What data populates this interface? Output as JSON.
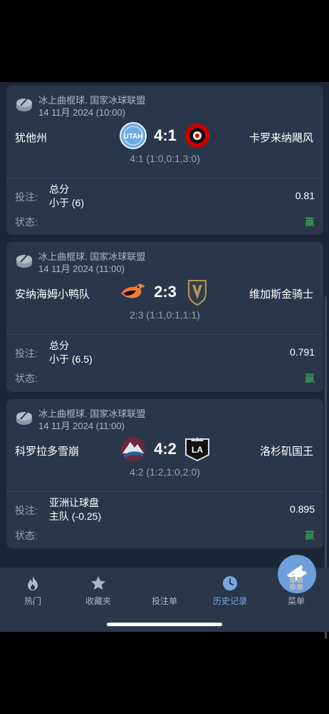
{
  "matches": [
    {
      "league": "冰上曲棍球. 国家冰球联盟",
      "date": "14 11月 2024 (10:00)",
      "home": "犹他州",
      "away": "卡罗来纳飓风",
      "score": "4:1",
      "periods": "4:1 (1:0,0:1,3:0)",
      "bet_label": "投注:",
      "market": "总分",
      "selection": "小于 (6)",
      "odds": "0.81",
      "status_label": "状态:",
      "status": "赢",
      "home_logo_text": "UTAH"
    },
    {
      "league": "冰上曲棍球. 国家冰球联盟",
      "date": "14 11月 2024 (11:00)",
      "home": "安纳海姆小鸭队",
      "away": "维加斯金骑士",
      "score": "2:3",
      "periods": "2:3 (1:1,0:1,1:1)",
      "bet_label": "投注:",
      "market": "总分",
      "selection": "小于 (6.5)",
      "odds": "0.791",
      "status_label": "状态:",
      "status": "赢"
    },
    {
      "league": "冰上曲棍球. 国家冰球联盟",
      "date": "14 11月 2024 (11:00)",
      "home": "科罗拉多雪崩",
      "away": "洛杉矶国王",
      "score": "4:2",
      "periods": "4:2 (1:2,1:0,2:0)",
      "bet_label": "投注:",
      "market": "亚洲让球盘",
      "selection": "主队 (-0.25)",
      "odds": "0.895",
      "status_label": "状态:",
      "status": "赢",
      "away_logo_text": "LA"
    }
  ],
  "tabs": [
    {
      "label": "热门",
      "icon": "fire-icon"
    },
    {
      "label": "收藏夹",
      "icon": "star-icon"
    },
    {
      "label": "投注单",
      "icon": "ticket-icon"
    },
    {
      "label": "历史记录",
      "icon": "clock-icon",
      "active": true
    },
    {
      "label": "菜单",
      "icon": "grid-icon"
    }
  ],
  "colors": {
    "win": "#3fbf59",
    "accent": "#6f9fdb",
    "card": "#2a374b",
    "background": "#1b2637"
  }
}
